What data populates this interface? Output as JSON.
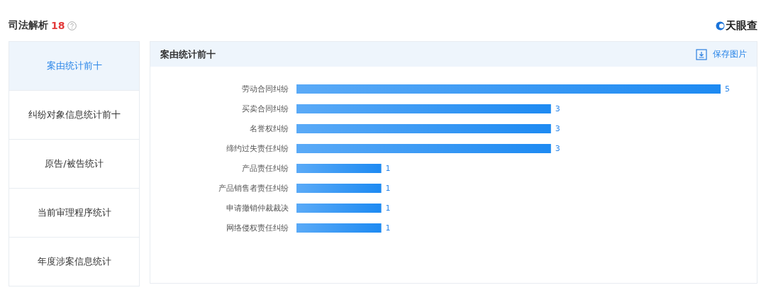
{
  "header": {
    "title": "司法解析",
    "count": "18",
    "logo": "天眼查"
  },
  "sidebar": {
    "items": [
      {
        "label": "案由统计前十",
        "selected": true
      },
      {
        "label": "纠纷对象信息统计前十",
        "selected": false
      },
      {
        "label": "原告/被告统计",
        "selected": false
      },
      {
        "label": "当前审理程序统计",
        "selected": false
      },
      {
        "label": "年度涉案信息统计",
        "selected": false
      }
    ]
  },
  "panel": {
    "title": "案由统计前十",
    "save_button": "保存图片",
    "chart_data": {
      "type": "bar",
      "orientation": "horizontal",
      "data_labels": true,
      "categories": [
        "劳动合同纠纷",
        "买卖合同纠纷",
        "名誉权纠纷",
        "缔约过失责任纠纷",
        "产品责任纠纷",
        "产品销售者责任纠纷",
        "申请撤销仲裁裁决",
        "网络侵权责任纠纷"
      ],
      "values": [
        5,
        3,
        3,
        3,
        1,
        1,
        1,
        1
      ]
    }
  }
}
